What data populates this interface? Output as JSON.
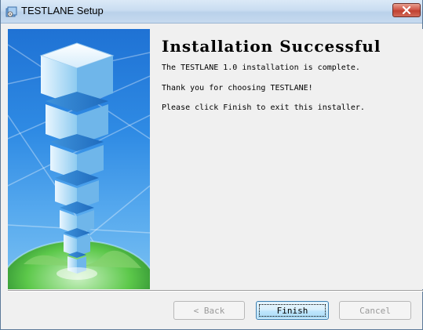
{
  "window": {
    "title": "TESTLANE Setup"
  },
  "content": {
    "heading": "Installation Successful",
    "line1": "The TESTLANE 1.0 installation is complete.",
    "line2": "Thank you for choosing TESTLANE!",
    "line3": "Please click Finish to exit this installer."
  },
  "buttons": {
    "back_label": "< Back",
    "finish_label": "Finish",
    "cancel_label": "Cancel"
  },
  "colors": {
    "titlebar": "#c9ddf1",
    "close_button": "#c04030",
    "banner_sky": "#2f8be4",
    "panel": "#f0f0f0"
  },
  "icons": {
    "app": "installer-icon",
    "close": "close-icon",
    "banner": "tower-globe-illustration"
  }
}
